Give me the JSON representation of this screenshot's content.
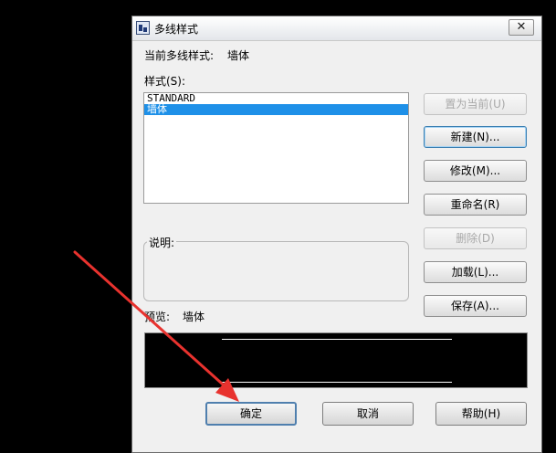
{
  "window": {
    "title": "多线样式",
    "close_glyph": "✕"
  },
  "current_style": {
    "label": "当前多线样式:",
    "value": "墙体"
  },
  "styles": {
    "label": "样式(S):",
    "items": [
      {
        "label": "STANDARD",
        "selected": false
      },
      {
        "label": "墙体",
        "selected": true
      }
    ]
  },
  "buttons": {
    "set_current": "置为当前(U)",
    "new": "新建(N)...",
    "modify": "修改(M)...",
    "rename": "重命名(R)",
    "delete": "删除(D)",
    "load": "加载(L)...",
    "save": "保存(A)..."
  },
  "description": {
    "label": "说明:",
    "value": ""
  },
  "preview": {
    "label": "预览:",
    "value": "墙体"
  },
  "footer": {
    "ok": "确定",
    "cancel": "取消",
    "help": "帮助(H)"
  },
  "colors": {
    "selection": "#1e90e8",
    "annotation_arrow": "#e8322e",
    "background": "#000000"
  }
}
